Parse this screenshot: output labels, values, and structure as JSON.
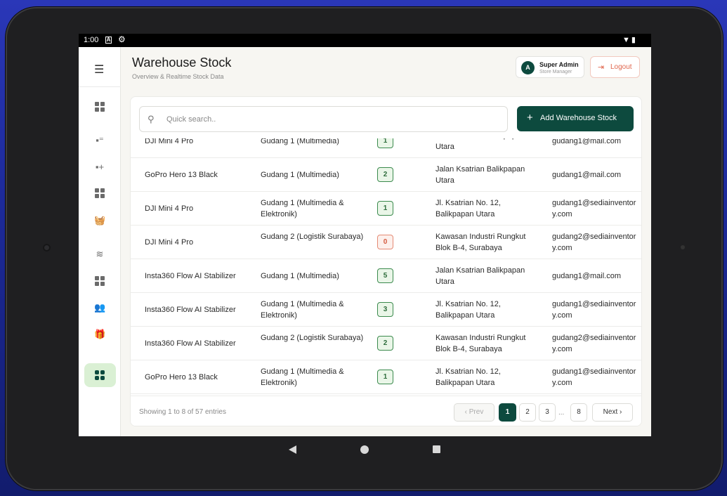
{
  "status_bar": {
    "time": "1:00",
    "notification_icon": "A"
  },
  "page": {
    "title": "Warehouse Stock",
    "subtitle": "Overview & Realtime Stock Data"
  },
  "user": {
    "initial": "A",
    "name": "Super Admin",
    "role": "Store Manager"
  },
  "logout_label": "Logout",
  "search": {
    "placeholder": "Quick search.."
  },
  "add_button_label": "Add Warehouse Stock",
  "rows": [
    {
      "product": "DJI Mini 4 Pro",
      "warehouse": "Gudang 1 (Multimedia)",
      "qty": "1",
      "address": "Jalan Ksatrian Balikpapan Utara",
      "email": "gudang1@mail.com"
    },
    {
      "product": "GoPro Hero 13 Black",
      "warehouse": "Gudang 1 (Multimedia)",
      "qty": "2",
      "address": "Jalan Ksatrian Balikpapan Utara",
      "email": "gudang1@mail.com"
    },
    {
      "product": "DJI Mini 4 Pro",
      "warehouse": "Gudang 1 (Multimedia & Elektronik)",
      "qty": "1",
      "address": "Jl. Ksatrian No. 12, Balikpapan Utara",
      "email": "gudang1@sediainventory.com"
    },
    {
      "product": "DJI Mini 4 Pro",
      "warehouse": "Gudang 2 (Logistik Surabaya)",
      "qty": "0",
      "address": "Kawasan Industri Rungkut Blok B-4, Surabaya",
      "email": "gudang2@sediainventory.com"
    },
    {
      "product": "Insta360 Flow AI Stabilizer",
      "warehouse": "Gudang 1 (Multimedia)",
      "qty": "5",
      "address": "Jalan Ksatrian Balikpapan Utara",
      "email": "gudang1@mail.com"
    },
    {
      "product": "Insta360 Flow AI Stabilizer",
      "warehouse": "Gudang 1 (Multimedia & Elektronik)",
      "qty": "3",
      "address": "Jl. Ksatrian No. 12, Balikpapan Utara",
      "email": "gudang1@sediainventory.com"
    },
    {
      "product": "Insta360 Flow AI Stabilizer",
      "warehouse": "Gudang 2 (Logistik Surabaya)",
      "qty": "2",
      "address": "Kawasan Industri Rungkut Blok B-4, Surabaya",
      "email": "gudang2@sediainventory.com"
    },
    {
      "product": "GoPro Hero 13 Black",
      "warehouse": "Gudang 1 (Multimedia & Elektronik)",
      "qty": "1",
      "address": "Jl. Ksatrian No. 12, Balikpapan Utara",
      "email": "gudang1@sediainventory.com"
    }
  ],
  "footer": {
    "info": "Showing 1 to 8 of 57 entries"
  },
  "pagination": {
    "prev": "Prev",
    "next": "Next",
    "pages": [
      "1",
      "2",
      "3",
      "8"
    ],
    "ellipsis": "...",
    "active": "1"
  },
  "colors": {
    "primary": "#0d4a3e",
    "active_nav_bg": "#daf0d4",
    "logout": "#e0664d",
    "qty_ok": "#2e6d3c",
    "qty_zero": "#d45a3f"
  },
  "sidebar_icons": [
    "dashboard-icon",
    "category-icon",
    "add-category-icon",
    "grid-icon",
    "basket-icon",
    "layers-icon",
    "apps-icon",
    "users-icon",
    "gift-icon",
    "warehouse-icon"
  ]
}
